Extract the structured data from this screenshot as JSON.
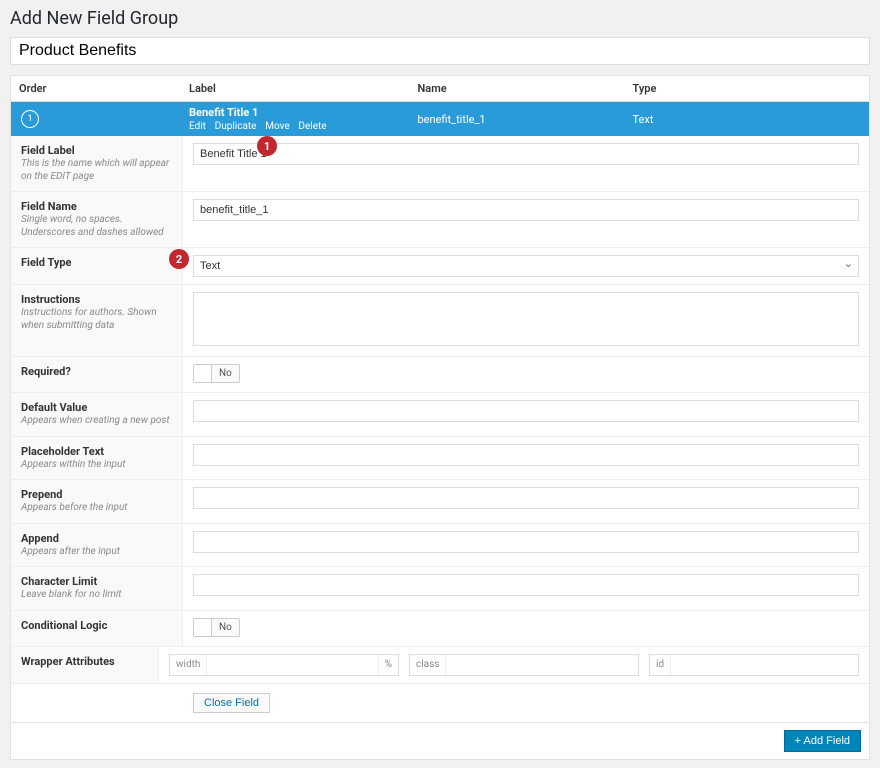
{
  "page": {
    "title": "Add New Field Group"
  },
  "group": {
    "title_value": "Product Benefits"
  },
  "table": {
    "headers": {
      "order": "Order",
      "label": "Label",
      "name": "Name",
      "type": "Type"
    },
    "row": {
      "order": "1",
      "label": "Benefit Title 1",
      "name": "benefit_title_1",
      "type": "Text",
      "actions": {
        "edit": "Edit",
        "duplicate": "Duplicate",
        "move": "Move",
        "delete": "Delete"
      }
    }
  },
  "settings": {
    "field_label": {
      "label": "Field Label",
      "hint": "This is the name which will appear on the EDIT page",
      "value": "Benefit Title 1"
    },
    "field_name": {
      "label": "Field Name",
      "hint": "Single word, no spaces. Underscores and dashes allowed",
      "value": "benefit_title_1"
    },
    "field_type": {
      "label": "Field Type",
      "value": "Text"
    },
    "instructions": {
      "label": "Instructions",
      "hint": "Instructions for authors. Shown when submitting data",
      "value": ""
    },
    "required": {
      "label": "Required?",
      "state": "No"
    },
    "default_value": {
      "label": "Default Value",
      "hint": "Appears when creating a new post",
      "value": ""
    },
    "placeholder_text": {
      "label": "Placeholder Text",
      "hint": "Appears within the input",
      "value": ""
    },
    "prepend": {
      "label": "Prepend",
      "hint": "Appears before the input",
      "value": ""
    },
    "append": {
      "label": "Append",
      "hint": "Appears after the input",
      "value": ""
    },
    "char_limit": {
      "label": "Character Limit",
      "hint": "Leave blank for no limit",
      "value": ""
    },
    "cond_logic": {
      "label": "Conditional Logic",
      "state": "No"
    },
    "wrapper": {
      "label": "Wrapper Attributes",
      "width_label": "width",
      "pct": "%",
      "class_label": "class",
      "id_label": "id"
    }
  },
  "buttons": {
    "close_field": "Close Field",
    "add_field": "+ Add Field"
  },
  "annotations": {
    "a1": "1",
    "a2": "2"
  }
}
